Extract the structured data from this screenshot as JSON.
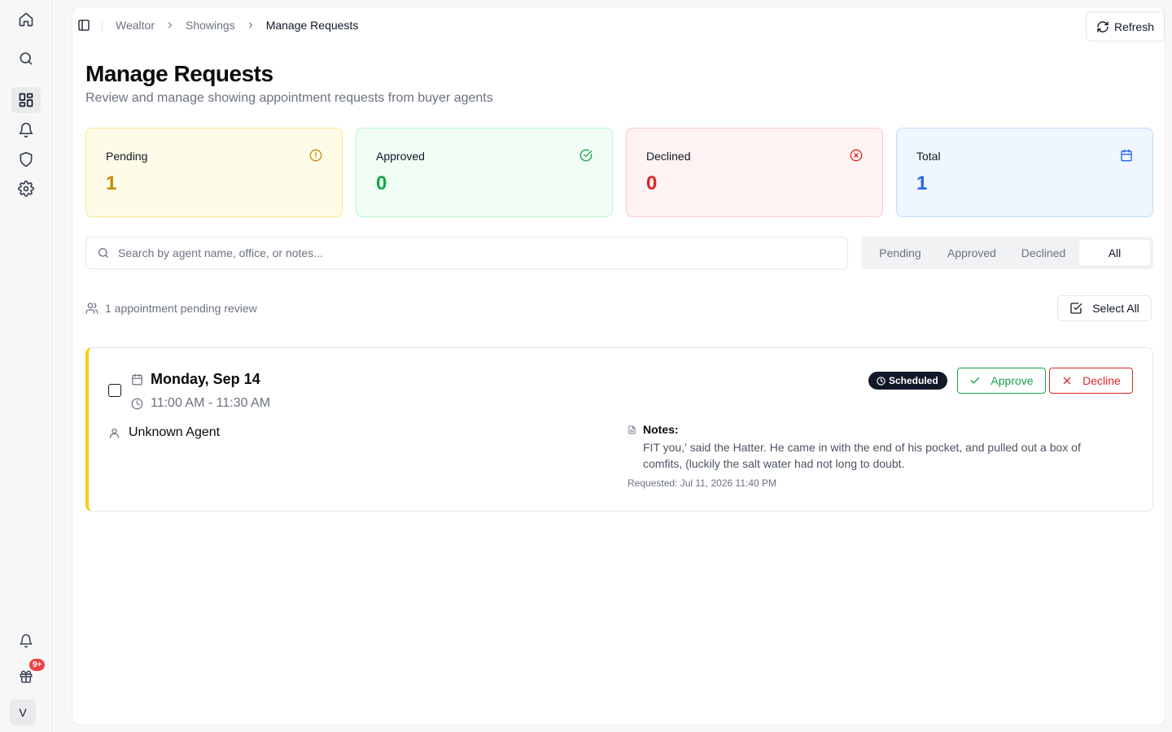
{
  "rail": {
    "notification_badge": "9+",
    "avatar_initial": "V"
  },
  "breadcrumb": {
    "items": [
      "Wealtor",
      "Showings",
      "Manage Requests"
    ]
  },
  "header": {
    "refresh_label": "Refresh",
    "title": "Manage Requests",
    "subtitle": "Review and manage showing appointment requests from buyer agents"
  },
  "stats": {
    "pending": {
      "label": "Pending",
      "value": "1",
      "color": "#ca8a04"
    },
    "approved": {
      "label": "Approved",
      "value": "0",
      "color": "#16a34a"
    },
    "declined": {
      "label": "Declined",
      "value": "0",
      "color": "#dc2626"
    },
    "total": {
      "label": "Total",
      "value": "1",
      "color": "#2563eb"
    }
  },
  "search": {
    "placeholder": "Search by agent name, office, or notes...",
    "value": ""
  },
  "filter_tabs": {
    "items": [
      "Pending",
      "Approved",
      "Declined",
      "All"
    ],
    "active": "All"
  },
  "summary": {
    "pending_text": "1 appointment pending review",
    "select_all_label": "Select All"
  },
  "appointment": {
    "date": "Monday, Sep 14",
    "time": "11:00 AM - 11:30 AM",
    "agent": "Unknown Agent",
    "status": "Scheduled",
    "approve_label": "Approve",
    "decline_label": "Decline",
    "notes_label": "Notes:",
    "notes": "FIT you,' said the Hatter. He came in with the end of his pocket, and pulled out a box of comfits, (luckily the salt water had not long to doubt.",
    "requested": "Requested: Jul 11, 2026 11:40 PM",
    "accent_color": "#facc15"
  }
}
